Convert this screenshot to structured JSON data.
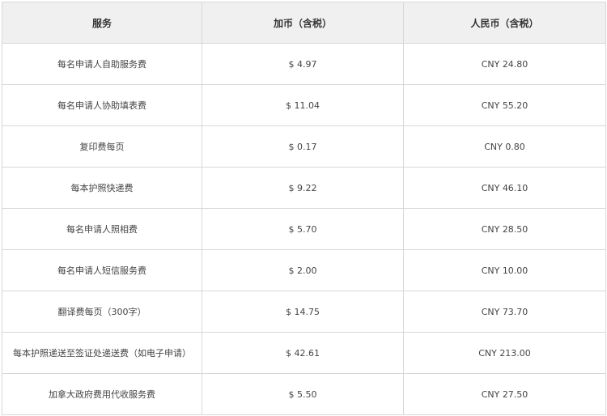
{
  "table": {
    "headers": {
      "service": "服务",
      "cad": "加币（含税）",
      "cny": "人民币（含税）"
    },
    "rows": [
      {
        "service": "每名申请人自助服务费",
        "cad": "$ 4.97",
        "cny": "CNY 24.80"
      },
      {
        "service": "每名申请人协助填表费",
        "cad": "$ 11.04",
        "cny": "CNY 55.20"
      },
      {
        "service": "复印费每页",
        "cad": "$ 0.17",
        "cny": "CNY 0.80"
      },
      {
        "service": "每本护照快递费",
        "cad": "$ 9.22",
        "cny": "CNY 46.10"
      },
      {
        "service": "每名申请人照相费",
        "cad": "$ 5.70",
        "cny": "CNY 28.50"
      },
      {
        "service": "每名申请人短信服务费",
        "cad": "$ 2.00",
        "cny": "CNY 10.00"
      },
      {
        "service": "翻译费每页（300字）",
        "cad": "$ 14.75",
        "cny": "CNY 73.70"
      },
      {
        "service": "每本护照递送至签证处递送费（如电子申请）",
        "cad": "$ 42.61",
        "cny": "CNY 213.00"
      },
      {
        "service": "加拿大政府费用代收服务费",
        "cad": "$ 5.50",
        "cny": "CNY 27.50"
      }
    ]
  }
}
